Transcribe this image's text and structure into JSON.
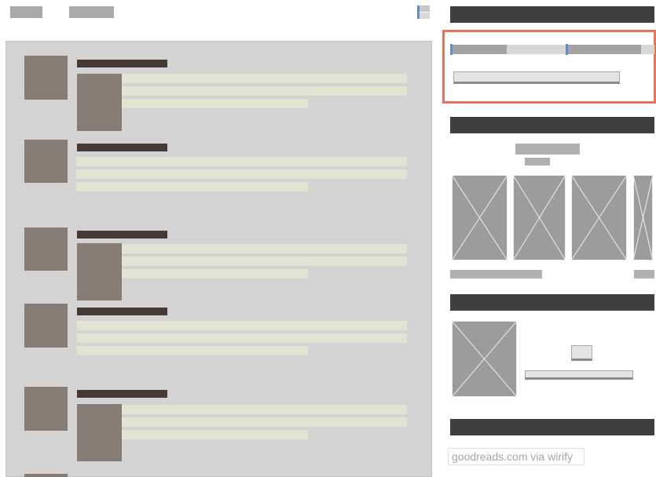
{
  "footer": {
    "text": "goodreads.com via wirify"
  },
  "colors": {
    "header_bar": "#3f3f3f",
    "highlight_border": "#e8735b",
    "feed_background": "#d3d3d3",
    "thumbnail": "#877c74",
    "title_bar": "#463832",
    "text_line": "#e3e3d1"
  },
  "icons": {
    "top_right": "layout-icon"
  },
  "feed": {
    "items": [
      {
        "has_inline_image": true
      },
      {
        "has_inline_image": false
      },
      {
        "has_inline_image": true
      },
      {
        "has_inline_image": false
      },
      {
        "has_inline_image": true
      }
    ]
  }
}
